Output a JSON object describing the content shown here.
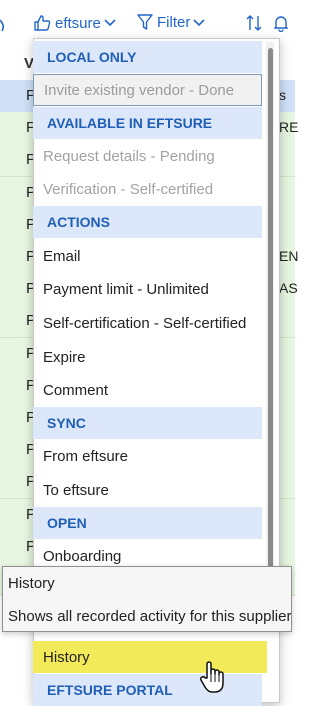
{
  "toolbar": {
    "eftsure_label": "eftsure",
    "filter_label": "Filter",
    "accent_color": "#2266c9"
  },
  "grid": {
    "header_fragment": "V",
    "rows": [
      {
        "c1": "P",
        "cr": "s",
        "selected": true
      },
      {
        "c1": "P",
        "cr": "RE",
        "selected": false
      },
      {
        "c1": "P",
        "cr": "",
        "selected": false
      },
      {
        "c1": "P",
        "cr": "",
        "selected": false
      },
      {
        "c1": "P",
        "cr": "",
        "selected": false
      },
      {
        "c1": "P",
        "cr": "EN",
        "selected": false
      },
      {
        "c1": "P",
        "cr": "AS",
        "selected": false
      },
      {
        "c1": "P",
        "cr": "",
        "selected": false
      },
      {
        "c1": "P",
        "cr": "",
        "selected": false
      },
      {
        "c1": "P",
        "cr": "",
        "selected": false
      },
      {
        "c1": "P",
        "cr": "",
        "selected": false
      },
      {
        "c1": "P",
        "cr": "",
        "selected": false
      },
      {
        "c1": "P",
        "cr": "",
        "selected": false
      },
      {
        "c1": "P",
        "cr": "",
        "selected": false
      },
      {
        "c1": "P",
        "cr": "",
        "selected": false
      },
      {
        "c1": "P",
        "cr": "",
        "selected": false
      }
    ],
    "row_color": "#e6f6e0",
    "selected_row_color": "#cfe0f7"
  },
  "menu": {
    "local_only_header": "LOCAL ONLY",
    "invite_vendor": "Invite existing vendor - Done",
    "available_header": "AVAILABLE IN EFTSURE",
    "request_details": "Request details - Pending",
    "verification": "Verification - Self-certified",
    "actions_header": "ACTIONS",
    "email": "Email",
    "payment_limit": "Payment limit - Unlimited",
    "self_certification": "Self-certification - Self-certified",
    "expire": "Expire",
    "comment": "Comment",
    "sync_header": "SYNC",
    "from_eftsure": "From eftsure",
    "to_eftsure": "To eftsure",
    "open_header": "OPEN",
    "onboarding": "Onboarding",
    "history": "History",
    "portal_header": "EFTSURE PORTAL",
    "section_color": "#dce7f9",
    "highlight_color": "#f2ea58"
  },
  "tooltip": {
    "title": "History",
    "body": "Shows all recorded activity for this supplier"
  },
  "icons": {
    "thumbs_up": "thumbs-up-icon",
    "filter": "filter-icon",
    "sort": "sort-icon",
    "bell": "bell-icon",
    "cursor": "hand-pointer-cursor"
  }
}
